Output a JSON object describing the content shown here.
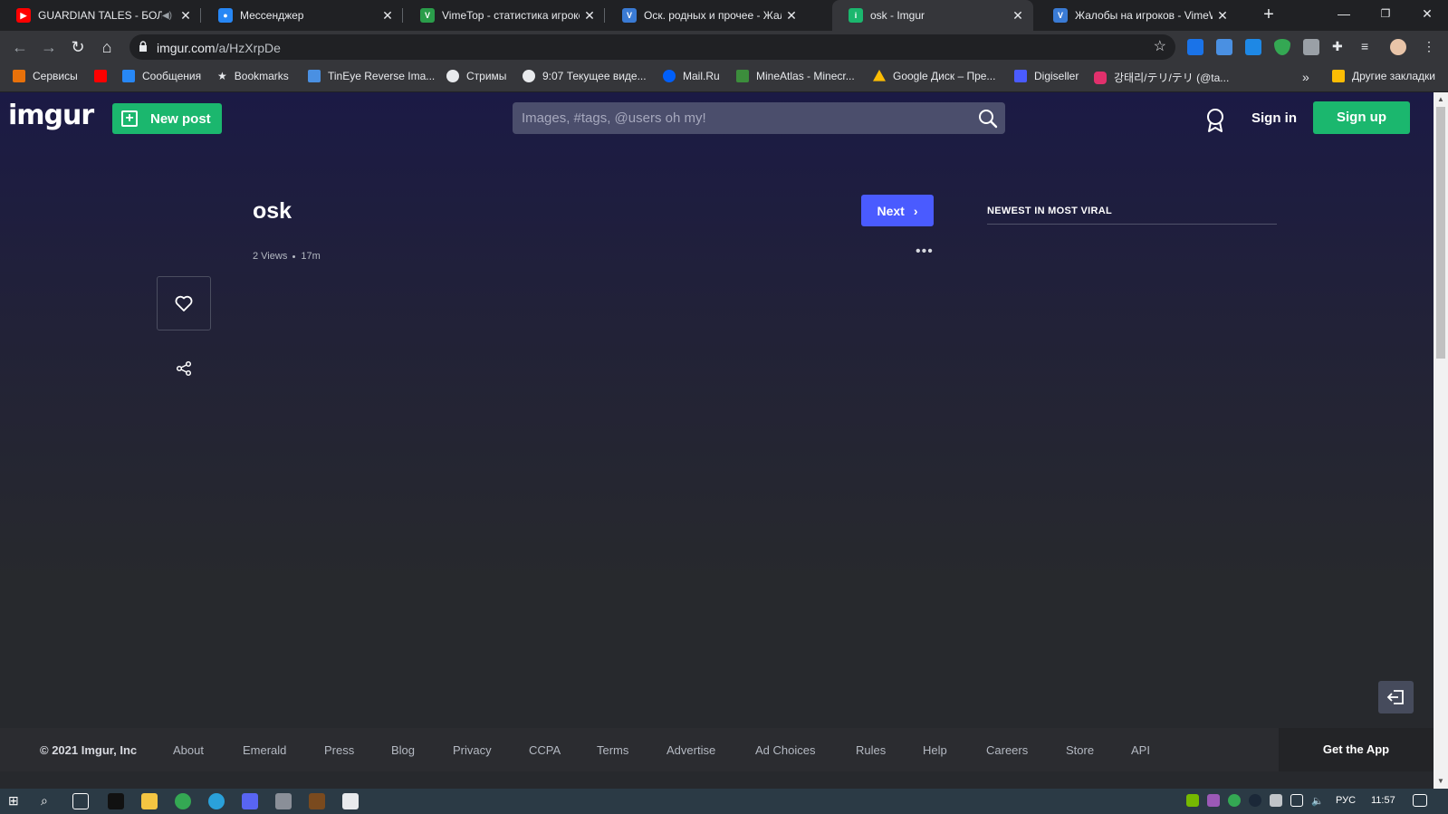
{
  "browser": {
    "tabs": [
      {
        "title": "GUARDIAN TALES - БОЛТО",
        "icon": "youtube-icon",
        "color": "#ff0000",
        "active": false
      },
      {
        "title": "Мессенджер",
        "icon": "vk-messenger-icon",
        "color": "#2787f5",
        "active": false
      },
      {
        "title": "VimeTop - статистика игроков",
        "icon": "vimetop-icon",
        "color": "#2a9d4a",
        "active": false
      },
      {
        "title": "Оск. родных и прочее - Жало",
        "icon": "vimeworld-icon",
        "color": "#3a7bd5",
        "active": false
      },
      {
        "title": "osk - Imgur",
        "icon": "imgur-icon",
        "color": "#1bb76e",
        "active": true
      },
      {
        "title": "Жалобы на игроков - VimeW",
        "icon": "vimeworld-icon",
        "color": "#3a7bd5",
        "active": false
      }
    ],
    "address": {
      "host": "imgur.com",
      "path": "/a/HzXrpDe"
    },
    "bookmarks": [
      {
        "label": "Сервисы",
        "icon": "apps-grid-icon",
        "color": "#e8710a"
      },
      {
        "label": "",
        "icon": "youtube-icon",
        "color": "#ff0000"
      },
      {
        "label": "Сообщения",
        "icon": "vk-icon",
        "color": "#2787f5"
      },
      {
        "label": "Bookmarks",
        "icon": "star-icon",
        "color": "#e8eaed"
      },
      {
        "label": "TinEye Reverse Ima...",
        "icon": "tineye-icon",
        "color": "#4a90e2"
      },
      {
        "label": "Стримы",
        "icon": "globe-icon",
        "color": "#e8eaed"
      },
      {
        "label": "9:07 Текущее виде...",
        "icon": "globe-icon",
        "color": "#e8eaed"
      },
      {
        "label": "Mail.Ru",
        "icon": "mailru-icon",
        "color": "#005ff9"
      },
      {
        "label": "MineAtlas - Minecr...",
        "icon": "mineatlas-icon",
        "color": "#3c8d3c"
      },
      {
        "label": "Google Диск – Пре...",
        "icon": "google-drive-icon",
        "color": "#fbbc04"
      },
      {
        "label": "Digiseller",
        "icon": "digiseller-icon",
        "color": "#4a5bff"
      },
      {
        "label": "강태리/テリ/テリ (@ta...",
        "icon": "instagram-icon",
        "color": "#e1306c"
      },
      {
        "label": "Другие закладки",
        "icon": "folder-icon",
        "color": "#fbbc04"
      }
    ]
  },
  "imgur": {
    "logo": "imgur",
    "new_post": "New post",
    "search_placeholder": "Images, #tags, @users oh my!",
    "sign_in": "Sign in",
    "sign_up": "Sign up",
    "post": {
      "title": "osk",
      "views": "2 Views",
      "age": "17m",
      "next": "Next"
    },
    "sidebar_heading": "NEWEST IN MOST VIRAL",
    "footer": {
      "copyright": "© 2021 Imgur, Inc",
      "links": [
        "About",
        "Emerald",
        "Press",
        "Blog",
        "Privacy",
        "CCPA",
        "Terms",
        "Advertise",
        "Ad Choices",
        "Rules",
        "Help",
        "Careers",
        "Store",
        "API"
      ],
      "get_app": "Get the App"
    }
  },
  "taskbar": {
    "lang": "РУС",
    "time": "11:57"
  },
  "colors": {
    "imgur_green": "#1bb76e",
    "next_blue": "#4a5bff",
    "page_top": "#1b1a45",
    "page_bottom": "#27292d"
  }
}
